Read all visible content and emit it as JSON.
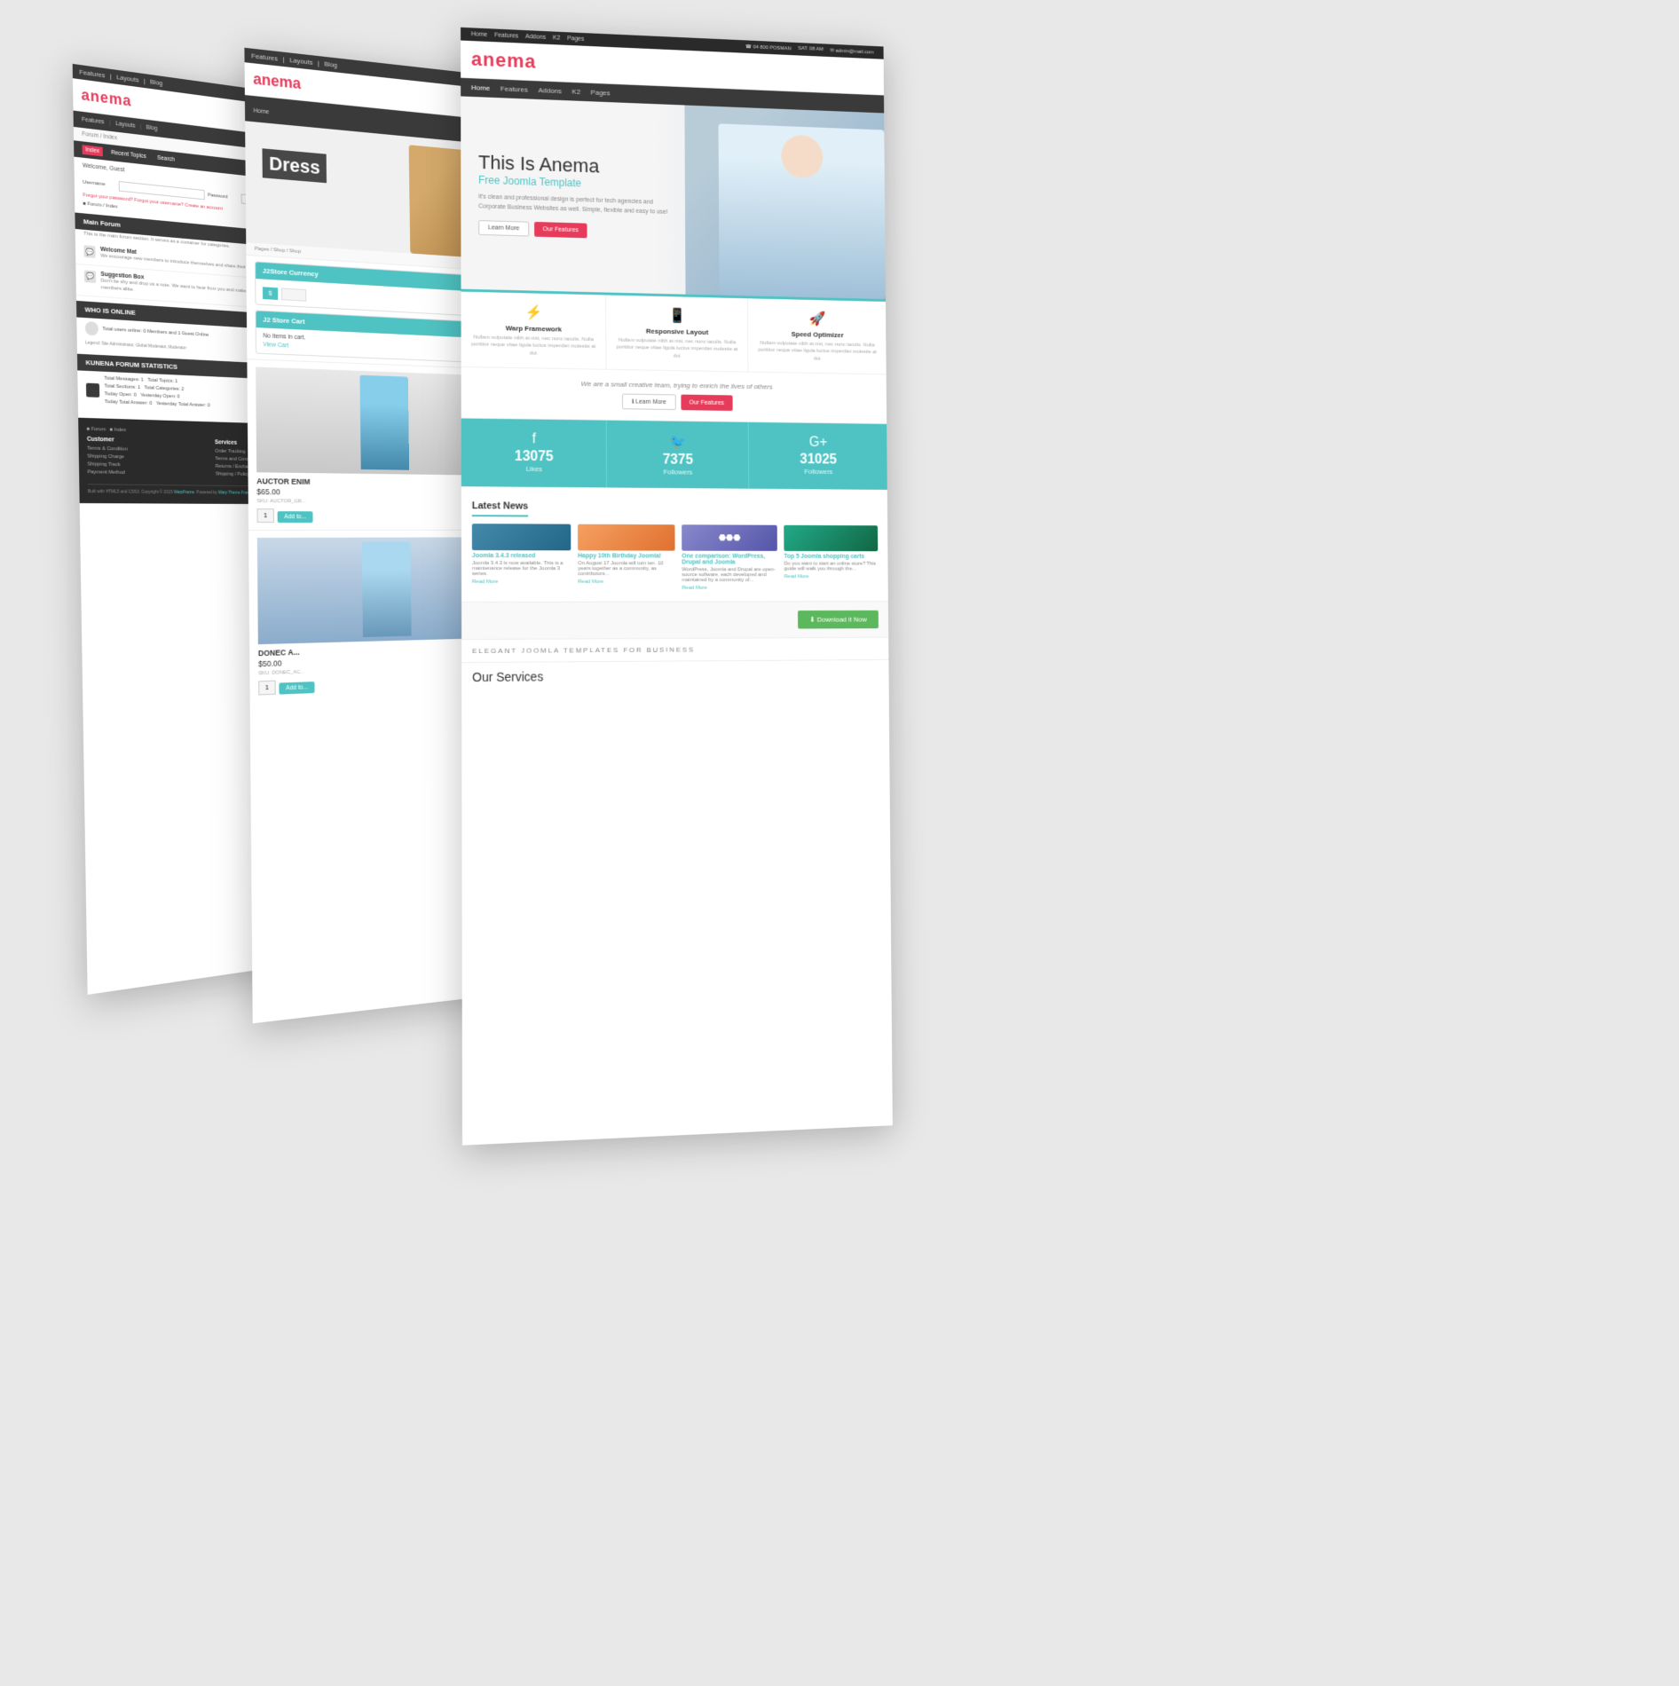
{
  "scene": {
    "background": "#e8e8e8"
  },
  "panels": {
    "back": {
      "type": "forum",
      "topbar": {
        "items": [
          "Features",
          "|",
          "Layouts",
          "|",
          "Blog"
        ]
      },
      "logo": "anema",
      "nav": {
        "items": [
          "Features",
          "|",
          "Layouts",
          "|",
          "Blog"
        ]
      },
      "breadcrumb": "Forum / Index",
      "index_tabs": [
        "Index",
        "Recent Topics",
        "Search"
      ],
      "welcome": "Welcome, Guest",
      "login": {
        "username_label": "Username",
        "password_label": "Password",
        "forgot_text": "Forgot your password?",
        "forgot_username": "Forgot your username?",
        "create": "Create an account"
      },
      "checkbox_label": "■ Forum / Index",
      "main_forum": {
        "header": "Main Forum",
        "desc": "This is the main forum section. It serves as a container for categories.",
        "topics": [
          {
            "title": "Welcome Mat",
            "desc": "We encourage new members to introduce themselves and share their interests."
          },
          {
            "title": "Suggestion Box",
            "desc": "Don't be shy and drop us a note. We want to hear from you and make this user friendly for our guests and members alike."
          }
        ]
      },
      "who_online": {
        "header": "WHO IS ONLINE",
        "text": "Total users online: 0 Members and 1 Guest Online",
        "legend": "Legend: Site Administrator, Global Moderator, Moderator"
      },
      "stats": {
        "header": "KUNENA FORUM STATISTICS",
        "items": [
          "Total Messages: 1",
          "Total Topics: 1",
          "Total Sections: 1",
          "Total Categories: 2",
          "Today Open: 0",
          "Yesterday Open: 0",
          "Today Total Answer: 0",
          "Yesterday Total Answer: 0"
        ]
      },
      "footer": {
        "nav": [
          "■ Forum",
          "■ Index"
        ],
        "cols": [
          {
            "title": "Customer",
            "items": [
              "Terms & Condition",
              "Shipping Charge",
              "Shipping Track",
              "Payment Method"
            ]
          },
          {
            "title": "Services",
            "items": [
              "Order Tracking",
              "Terms and Conditions",
              "Returns / Exchange",
              "Shipping / Policy"
            ]
          }
        ],
        "copyright": "Built with HTML5 and CSS3. Copyright © 2015 WarpFrame. Powered by Warp Theme Framework."
      }
    },
    "mid": {
      "type": "shop",
      "topbar": {
        "items": [
          "Features",
          "|",
          "Layouts",
          "|",
          "Blog"
        ]
      },
      "logo": "anema",
      "nav": {
        "items": [
          "Home"
        ]
      },
      "hero": {
        "text": "Dress"
      },
      "breadcrumb": "Pages / Shop / Shop",
      "currency_widget": {
        "header": "J2Store Currency",
        "currency_symbol": "$"
      },
      "cart_widget": {
        "header": "J2 Store Cart",
        "empty": "No items in cart.",
        "view_cart": "View Cart"
      },
      "products": [
        {
          "name": "AUCTOR ENIM",
          "price": "$65.00",
          "sku": "SKU: AUCTOR_GR...",
          "btn": "Add to..."
        },
        {
          "name": "DONEC A...",
          "price": "$50.00",
          "sku": "SKU: DONEC_AC...",
          "btn": "Add to..."
        }
      ]
    },
    "front": {
      "type": "main",
      "topbar": {
        "nav": [
          "Home"
        ],
        "info": [
          "☎ 04 800 POSMAN",
          "SAT: 08 AM",
          "✉ admin@mail.com"
        ]
      },
      "logo": "anema",
      "nav": {
        "items": [
          "Home",
          "Features",
          "Addons",
          "K2",
          "Pages"
        ]
      },
      "hero": {
        "title": "This Is Anema",
        "subtitle": "Free Joomla Template",
        "desc": "It's clean and professional design is perfect for tech agencies and Corporate Business Websites as well. Simple, flexible and easy to use!",
        "btn_learn": "Learn More",
        "btn_features": "Our Features"
      },
      "features": [
        {
          "icon": "⚡",
          "title": "Warp Framework",
          "desc": "Nullam vulputate nibh at nisi, nec nunc iaculis. Nulla porttitor neque vitae ligula luctus imperdiet molestie at dui."
        },
        {
          "icon": "📱",
          "title": "Responsive Layout",
          "desc": "Nullam vulputate nibh at nisi, nec nunc iaculis. Nulla porttitor neque vitae ligula luctus imperdiet molestie at dui."
        },
        {
          "icon": "🚀",
          "title": "Speed Optimizer",
          "desc": "Nullam vulputate nibh at nisi, nec nunc iaculis. Nulla porttitor neque vitae ligula luctus imperdiet molestie at dui."
        }
      ],
      "cta": {
        "text": "We are a small creative team, trying to enrich the lives of others",
        "btn_learn": "Learn More",
        "btn_features": "Our Features"
      },
      "social": [
        {
          "icon": "f",
          "count": "13075",
          "label": "Likes"
        },
        {
          "icon": "🐦",
          "count": "7375",
          "label": "Followers"
        },
        {
          "icon": "G+",
          "count": "31025",
          "label": "Followers"
        }
      ],
      "news": {
        "title": "Latest News",
        "items": [
          {
            "title": "Joomla 3.4.3 released",
            "desc": "Joomla 3.4.3 is now available. This is a maintenance release for the Joomla 3 series.",
            "read_more": "Read More"
          },
          {
            "title": "Happy 10th Birthday Joomla!",
            "desc": "On August 17 Joomla will turn ten. 10 years together as a community, as contributors...",
            "read_more": "Read More"
          },
          {
            "title": "One comparison: WordPress, Drupal and Joomla",
            "desc": "WordPress, Joomla and Drupal are open-source software, each developed and maintained by a community of...",
            "read_more": "Read More"
          },
          {
            "title": "Top 5 Joomla shopping carts",
            "desc": "Do you want to start an online store? This guide will walk you through the...",
            "read_more": "Read More"
          }
        ]
      },
      "download": {
        "btn": "⬇ Download it Now"
      },
      "elegant": "ELEGANT JOOMLA TEMPLATES FOR BUSINESS",
      "services": {
        "title": "Our Services"
      }
    }
  }
}
